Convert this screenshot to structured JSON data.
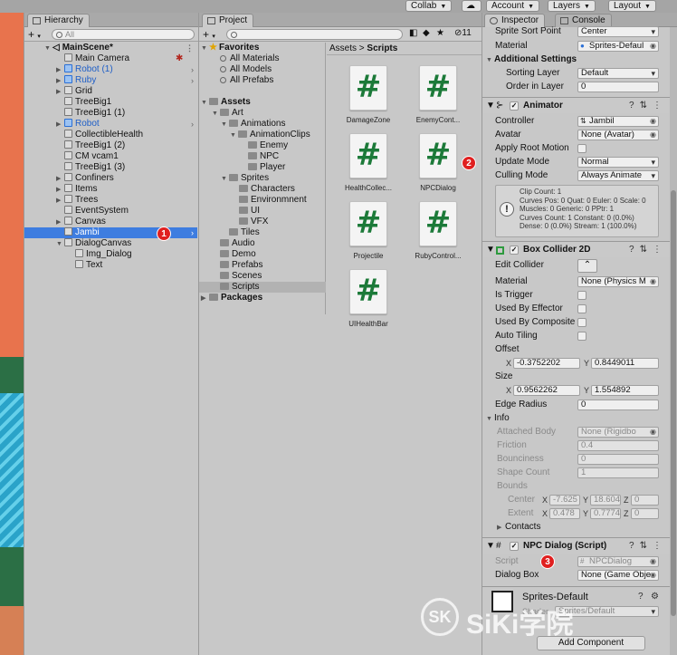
{
  "toolbar": {
    "collab_label": "Collab",
    "account_label": "Account",
    "layers_label": "Layers",
    "layout_label": "Layout"
  },
  "hierarchy": {
    "tab_label": "Hierarchy",
    "search_placeholder": "All",
    "items": [
      {
        "label": "MainScene*",
        "type": "scene"
      },
      {
        "label": "Main Camera"
      },
      {
        "label": "Robot (1)",
        "blue": true
      },
      {
        "label": "Ruby",
        "blue": true
      },
      {
        "label": "Grid"
      },
      {
        "label": "TreeBig1"
      },
      {
        "label": "TreeBig1 (1)"
      },
      {
        "label": "Robot",
        "blue": true
      },
      {
        "label": "CollectibleHealth"
      },
      {
        "label": "TreeBig1 (2)"
      },
      {
        "label": "CM vcam1"
      },
      {
        "label": "TreeBig1 (3)"
      },
      {
        "label": "Confiners"
      },
      {
        "label": "Items"
      },
      {
        "label": "Trees"
      },
      {
        "label": "EventSystem"
      },
      {
        "label": "Canvas"
      },
      {
        "label": "Jambi",
        "selected": true
      },
      {
        "label": "DialogCanvas"
      },
      {
        "label": "Img_Dialog"
      },
      {
        "label": "Text"
      }
    ]
  },
  "project": {
    "tab_label": "Project",
    "hidden_count": "11",
    "tree": {
      "favorites_label": "Favorites",
      "favorites": [
        "All Materials",
        "All Models",
        "All Prefabs"
      ],
      "assets_label": "Assets",
      "art": "Art",
      "animations": "Animations",
      "animation_clips": "AnimationClips",
      "enemy": "Enemy",
      "npc": "NPC",
      "player": "Player",
      "sprites": "Sprites",
      "characters": "Characters",
      "environment": "Environmnent",
      "ui": "UI",
      "vfx": "VFX",
      "tiles": "Tiles",
      "audio": "Audio",
      "demo": "Demo",
      "prefabs": "Prefabs",
      "scenes": "Scenes",
      "scripts": "Scripts",
      "packages_label": "Packages"
    },
    "breadcrumb": {
      "root": "Assets",
      "sep": ">",
      "current": "Scripts"
    },
    "assets": [
      {
        "label": "DamageZone",
        "glyph": "#"
      },
      {
        "label": "EnemyCont...",
        "glyph": "#"
      },
      {
        "label": "HealthCollec...",
        "glyph": "#"
      },
      {
        "label": "NPCDialog",
        "glyph": "#"
      },
      {
        "label": "Projectile",
        "glyph": "#"
      },
      {
        "label": "RubyControl...",
        "glyph": "#"
      },
      {
        "label": "UIHealthBar",
        "glyph": "#"
      }
    ]
  },
  "inspector": {
    "tab_label": "Inspector",
    "console_tab_label": "Console",
    "sprite_renderer": {
      "sprite_sort_point_label": "Sprite Sort Point",
      "sprite_sort_point_value": "Center",
      "material_label": "Material",
      "material_value": "Sprites-Defaul",
      "additional_settings": "Additional Settings",
      "sorting_layer_label": "Sorting Layer",
      "sorting_layer_value": "Default",
      "order_in_layer_label": "Order in Layer",
      "order_in_layer_value": "0"
    },
    "animator": {
      "title": "Animator",
      "controller_label": "Controller",
      "controller_value": "Jambil",
      "avatar_label": "Avatar",
      "avatar_value": "None (Avatar)",
      "apply_root_motion_label": "Apply Root Motion",
      "update_mode_label": "Update Mode",
      "update_mode_value": "Normal",
      "culling_mode_label": "Culling Mode",
      "culling_mode_value": "Always Animate",
      "info_lines": [
        "Clip Count: 1",
        "Curves Pos: 0 Quat: 0 Euler: 0 Scale: 0",
        "Muscles: 0 Generic: 0 PPtr: 1",
        "Curves Count: 1 Constant: 0 (0.0%)",
        "Dense: 0 (0.0%) Stream: 1 (100.0%)"
      ]
    },
    "box_collider": {
      "title": "Box Collider 2D",
      "edit_collider_label": "Edit Collider",
      "material_label": "Material",
      "material_value": "None (Physics M",
      "is_trigger_label": "Is Trigger",
      "used_by_effector_label": "Used By Effector",
      "used_by_composite_label": "Used By Composite",
      "auto_tiling_label": "Auto Tiling",
      "offset_label": "Offset",
      "offset_x": "-0.3752202",
      "offset_y": "0.8449011",
      "size_label": "Size",
      "size_x": "0.9562262",
      "size_y": "1.554892",
      "edge_radius_label": "Edge Radius",
      "edge_radius_value": "0",
      "info_label": "Info",
      "attached_body_label": "Attached Body",
      "attached_body_value": "None (Rigidbo",
      "friction_label": "Friction",
      "friction_value": "0.4",
      "bounciness_label": "Bounciness",
      "bounciness_value": "0",
      "shape_count_label": "Shape Count",
      "shape_count_value": "1",
      "bounds_label": "Bounds",
      "center_label": "Center",
      "center_x": "-7.625",
      "center_y": "18.604",
      "center_z": "0",
      "extent_label": "Extent",
      "extent_x": "0.478",
      "extent_y": "0.7774",
      "extent_z": "0",
      "contacts_label": "Contacts"
    },
    "npc_dialog": {
      "title": "NPC Dialog (Script)",
      "script_label": "Script",
      "script_value": "NPCDialog",
      "dialog_box_label": "Dialog Box",
      "dialog_box_value": "None (Game Obje"
    },
    "material_footer": {
      "name": "Sprites-Default",
      "shader_label": "Shader",
      "shader_value": "Sprites/Default",
      "add_component_label": "Add Component"
    }
  },
  "annotations": [
    "1",
    "2",
    "3"
  ],
  "watermark": "SiKi学院",
  "colors": {
    "selection": "#3e7de0",
    "badge": "#e02020",
    "script_icon": "#1c7a39"
  }
}
